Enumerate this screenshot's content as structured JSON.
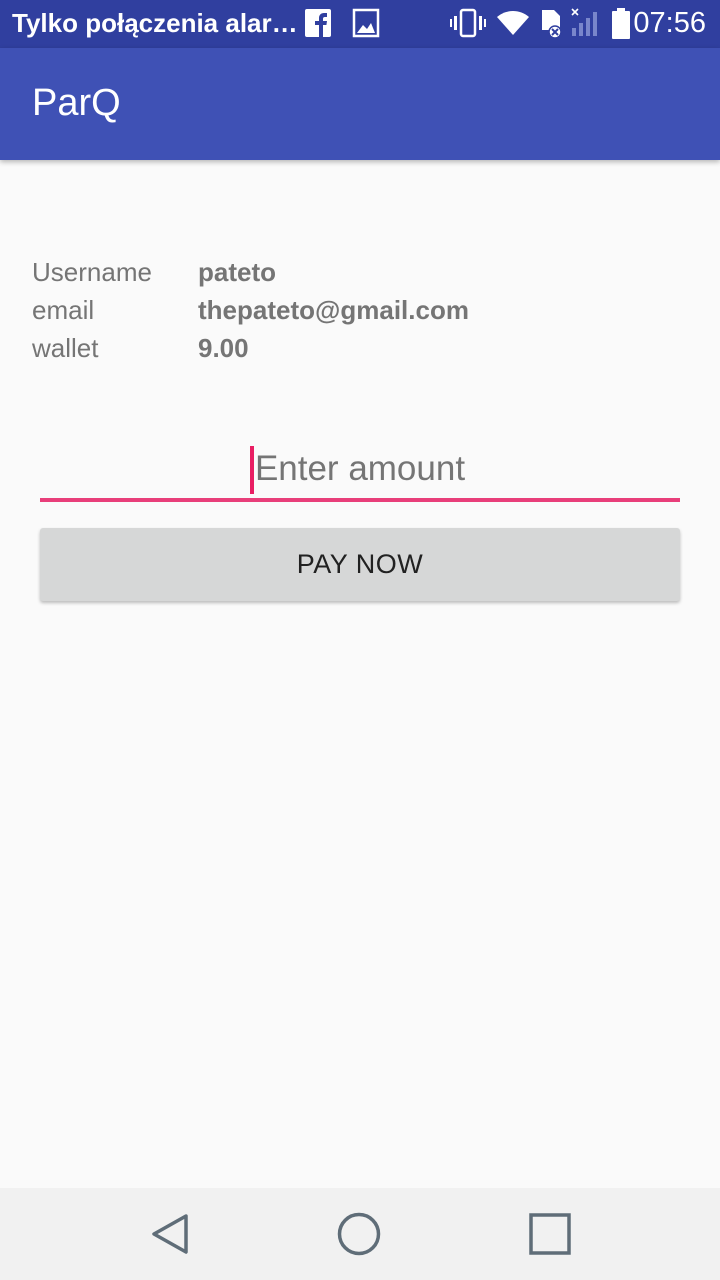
{
  "status_bar": {
    "carrier_text": "Tylko połączenia alar…",
    "time": "07:56",
    "icons": [
      "facebook-icon",
      "image-icon",
      "vibrate-icon",
      "wifi-icon",
      "sd-card-icon",
      "signal-icon",
      "battery-icon"
    ]
  },
  "app_bar": {
    "title": "ParQ"
  },
  "profile": {
    "username_label": "Username",
    "username_value": "pateto",
    "email_label": "email",
    "email_value": "thepateto@gmail.com",
    "wallet_label": "wallet",
    "wallet_value": "9.00"
  },
  "amount_input": {
    "placeholder": "Enter amount",
    "value": ""
  },
  "pay_button": {
    "label": "PAY NOW"
  },
  "nav_bar": {
    "icons": [
      "back-icon",
      "home-icon",
      "recents-icon"
    ]
  },
  "colors": {
    "primary": "#3f51b5",
    "primary_dark": "#303f9f",
    "accent": "#e91e63",
    "background": "#fafafa",
    "button": "#d6d7d7"
  }
}
